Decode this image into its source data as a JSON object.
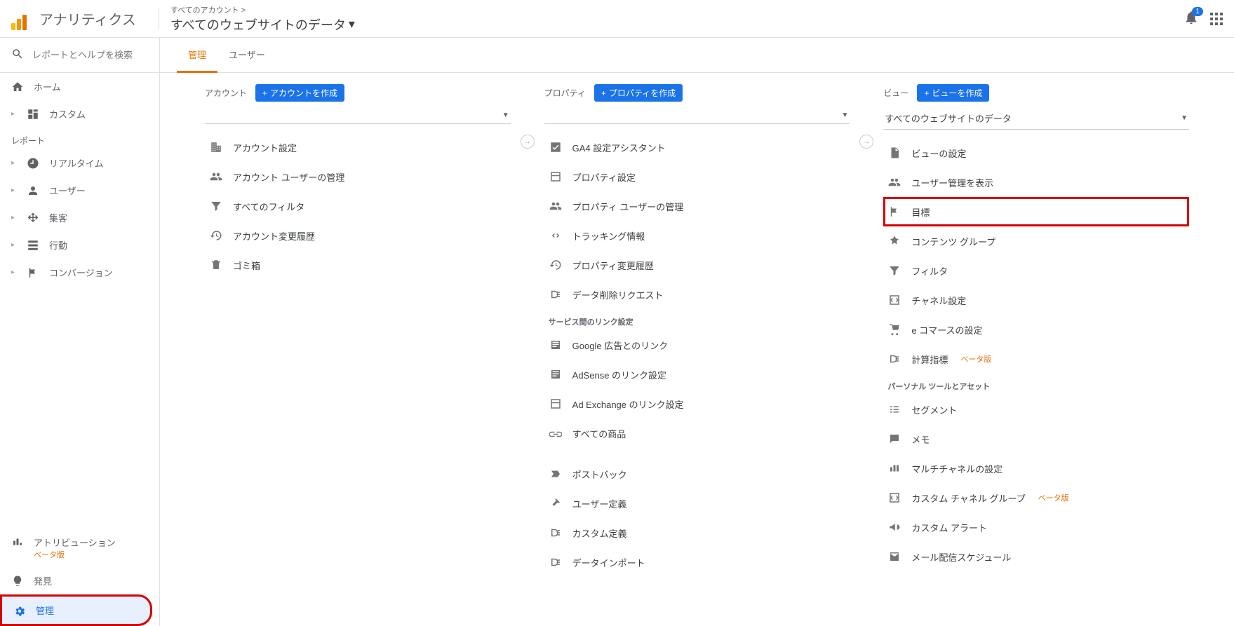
{
  "header": {
    "product": "アナリティクス",
    "breadcrumb_top": "すべてのアカウント >",
    "breadcrumb_main": "すべてのウェブサイトのデータ",
    "notifications": "1"
  },
  "sidebar": {
    "search_placeholder": "レポートとヘルプを検索",
    "home": "ホーム",
    "custom": "カスタム",
    "section_reports": "レポート",
    "realtime": "リアルタイム",
    "audience": "ユーザー",
    "acquisition": "集客",
    "behavior": "行動",
    "conversions": "コンバージョン",
    "attribution": "アトリビューション",
    "beta": "ベータ版",
    "discover": "発見",
    "admin": "管理"
  },
  "tabs": {
    "admin": "管理",
    "user": "ユーザー"
  },
  "cols": {
    "account": {
      "label": "アカウント",
      "create": "アカウントを作成",
      "select": "",
      "items": [
        "アカウント設定",
        "アカウント ユーザーの管理",
        "すべてのフィルタ",
        "アカウント変更履歴",
        "ゴミ箱"
      ]
    },
    "property": {
      "label": "プロパティ",
      "create": "プロパティを作成",
      "select": "",
      "items": [
        "GA4 設定アシスタント",
        "プロパティ設定",
        "プロパティ ユーザーの管理",
        "トラッキング情報",
        "プロパティ変更履歴",
        "データ削除リクエスト"
      ],
      "subsection": "サービス間のリンク設定",
      "items2": [
        "Google 広告とのリンク",
        "AdSense のリンク設定",
        "Ad Exchange のリンク設定",
        "すべての商品",
        "ポストバック",
        "ユーザー定義",
        "カスタム定義",
        "データインポート"
      ]
    },
    "view": {
      "label": "ビュー",
      "create": "ビューを作成",
      "select": "すべてのウェブサイトのデータ",
      "items": [
        "ビューの設定",
        "ユーザー管理を表示",
        "目標",
        "コンテンツ グループ",
        "フィルタ",
        "チャネル設定",
        "e コマースの設定"
      ],
      "calc_metrics": "計算指標",
      "subsection": "パーソナル ツールとアセット",
      "items2": [
        "セグメント",
        "メモ",
        "マルチチャネルの設定"
      ],
      "custom_channel": "カスタム チャネル グループ",
      "items3": [
        "カスタム アラート",
        "メール配信スケジュール"
      ]
    }
  }
}
